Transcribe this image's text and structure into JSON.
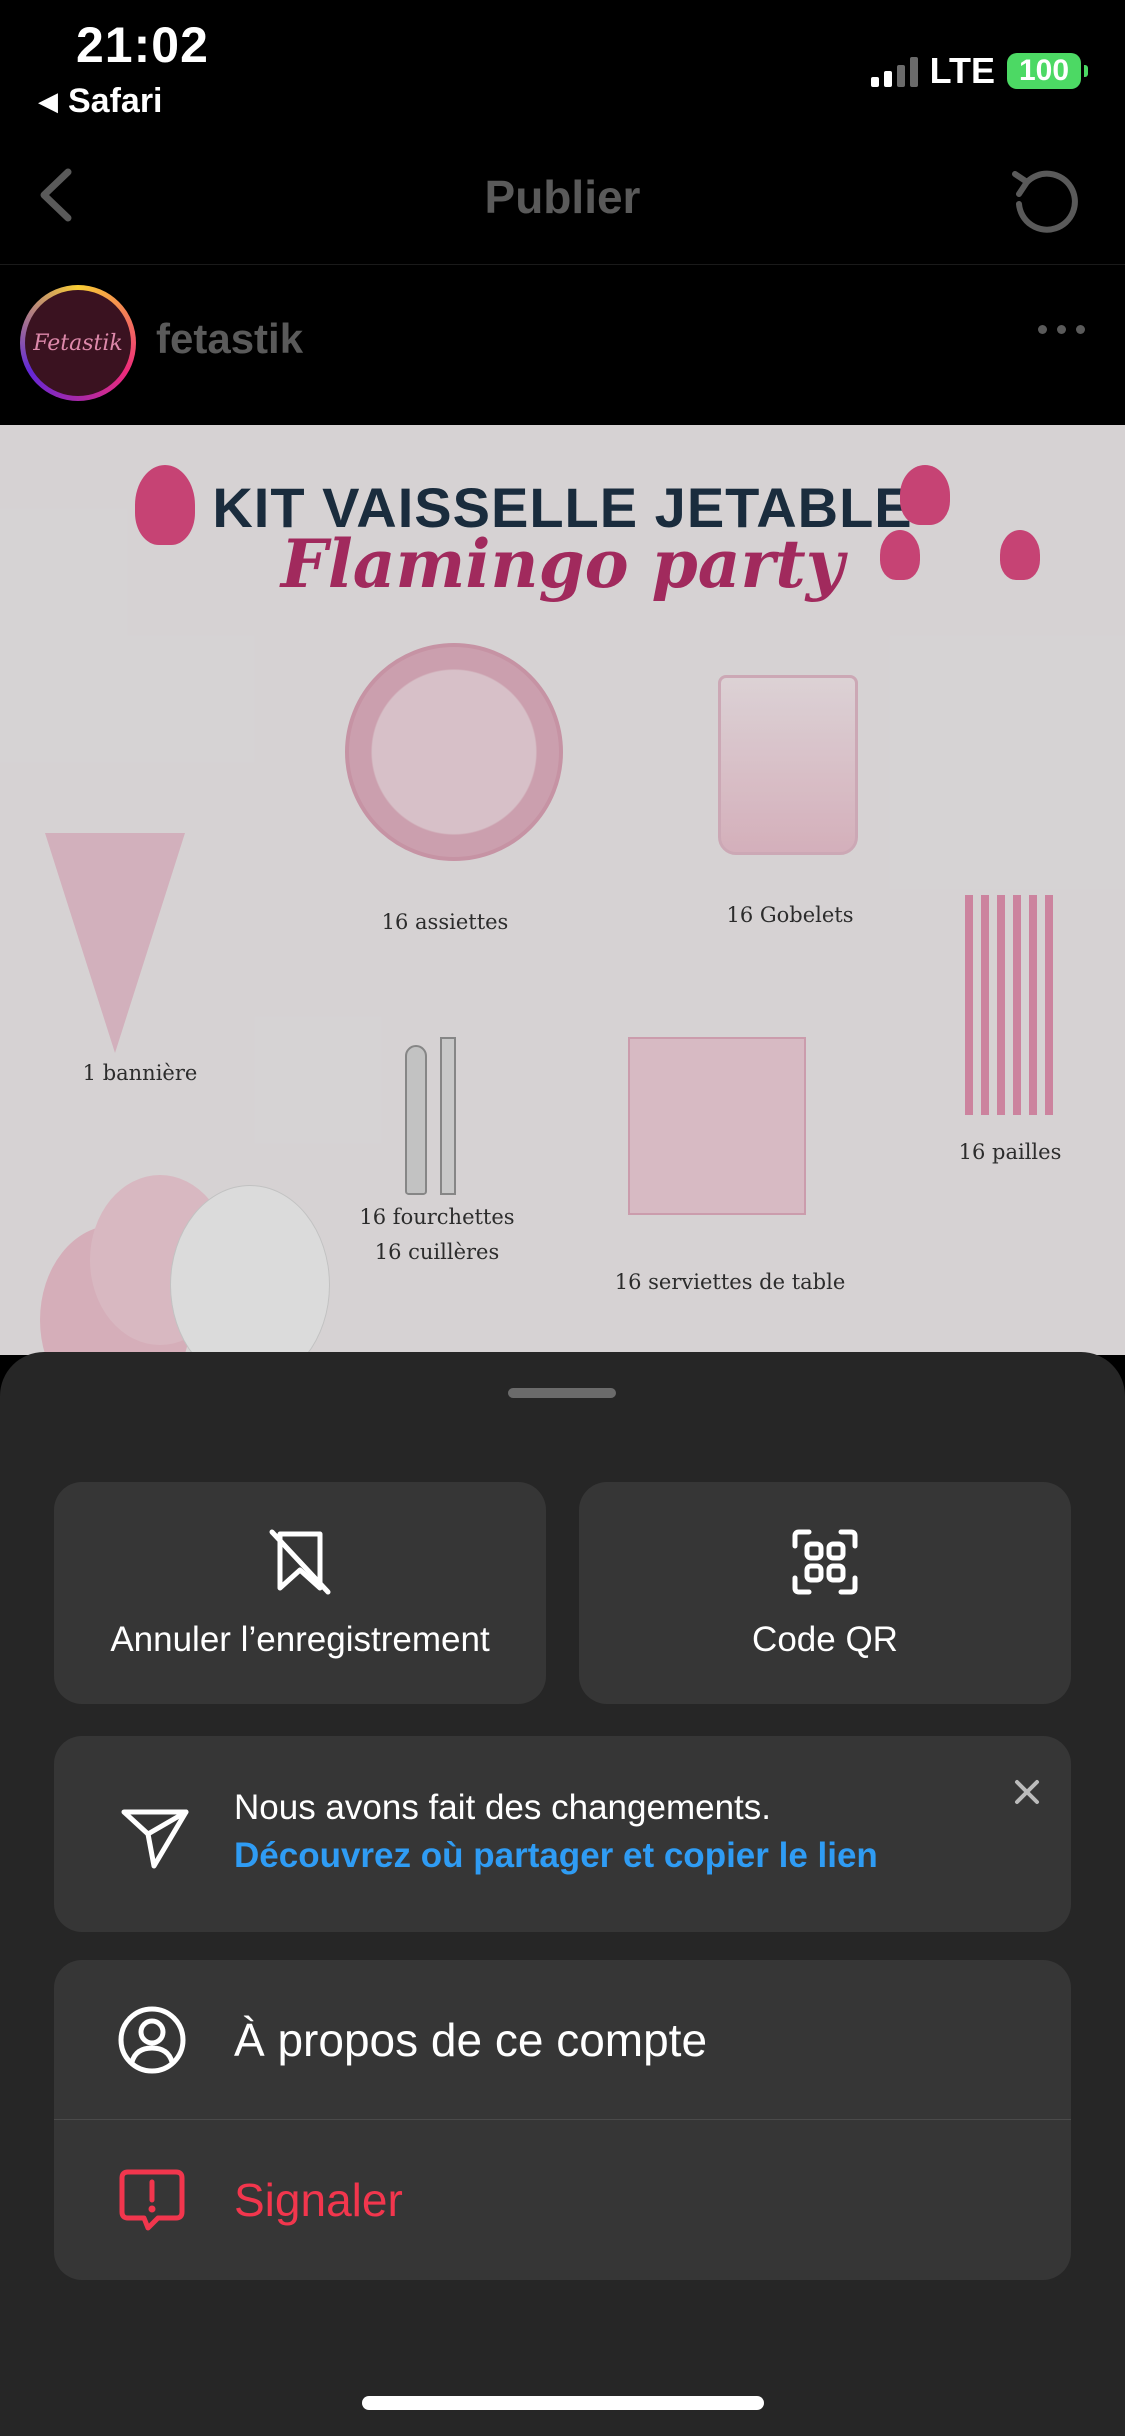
{
  "status_bar": {
    "time": "21:02",
    "back_app": "Safari",
    "network": "LTE",
    "battery": "100"
  },
  "header": {
    "title": "Publier"
  },
  "post": {
    "username": "fetastik",
    "avatar_text": "Fetastik",
    "image": {
      "title": "KIT VAISSELLE JETABLE",
      "subtitle": "Flamingo party",
      "captions": {
        "plates": "16 assiettes",
        "cups": "16 Gobelets",
        "banner": "1 bannière",
        "straws": "16 pailles",
        "forks": "16 fourchettes",
        "spoons": "16 cuillères",
        "napkins": "16 serviettes de table"
      }
    }
  },
  "sheet": {
    "unsave_label": "Annuler l’enregistrement",
    "qr_label": "Code QR",
    "notice": {
      "text": "Nous avons fait des changements.",
      "link": "Découvrez où partager et copier le lien"
    },
    "menu": {
      "about_label": "À propos de ce compte",
      "report_label": "Signaler"
    }
  },
  "colors": {
    "sheet_bg": "#262626",
    "card_bg": "#363636",
    "link": "#2f9cf4",
    "danger": "#f2364d",
    "battery": "#4cd964"
  }
}
